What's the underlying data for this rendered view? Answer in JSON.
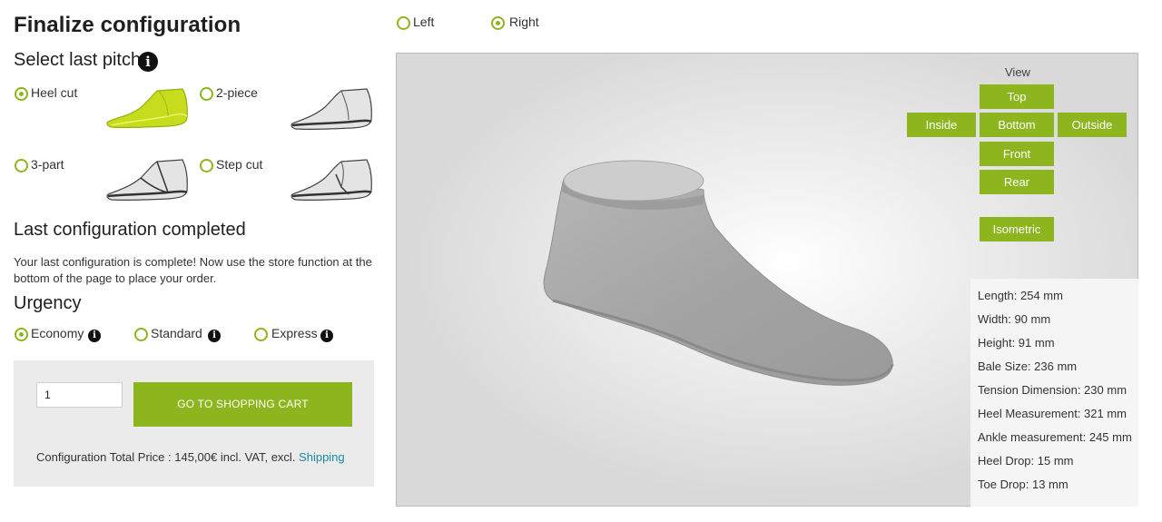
{
  "page": {
    "title": "Finalize configuration",
    "pitch_heading": "Select last pitch",
    "completed_heading": "Last configuration completed",
    "completed_text_1": "Your last configuration is complete! Now use the store function at the",
    "completed_text_2": "bottom of the page to place your order.",
    "urgency_heading": "Urgency"
  },
  "side_options": [
    {
      "label": "Left",
      "checked": false
    },
    {
      "label": "Right",
      "checked": true
    }
  ],
  "pitch_options": [
    {
      "label": "Heel cut",
      "checked": true
    },
    {
      "label": "2-piece",
      "checked": false
    },
    {
      "label": "3-part",
      "checked": false
    },
    {
      "label": "Step cut",
      "checked": false
    }
  ],
  "urgency_options": [
    {
      "label": "Economy",
      "checked": true
    },
    {
      "label": "Standard",
      "checked": false
    },
    {
      "label": "Express",
      "checked": false
    }
  ],
  "cart": {
    "quantity": "1",
    "button_label": "GO TO SHOPPING CART",
    "price_text": "Configuration Total Price : 145,00€ incl. VAT, excl. ",
    "shipping_link": "Shipping"
  },
  "viewer": {
    "view_label": "View",
    "buttons": {
      "top": "Top",
      "inside": "Inside",
      "bottom": "Bottom",
      "outside": "Outside",
      "front": "Front",
      "rear": "Rear",
      "isometric": "Isometric"
    },
    "measurements": [
      "Length: 254 mm",
      "Width: 90 mm",
      "Height: 91 mm",
      "Bale Size: 236 mm",
      "Tension Dimension: 230 mm",
      "Heel Measurement: 321 mm",
      "Ankle measurement: 245 mm",
      "Heel Drop: 15 mm",
      "Toe Drop: 13 mm"
    ]
  },
  "icons": {
    "info": "info-icon",
    "radio": "radio-button"
  },
  "colors": {
    "accent": "#8db61e",
    "link": "#1a8aa8",
    "panel": "#ebebeb"
  }
}
